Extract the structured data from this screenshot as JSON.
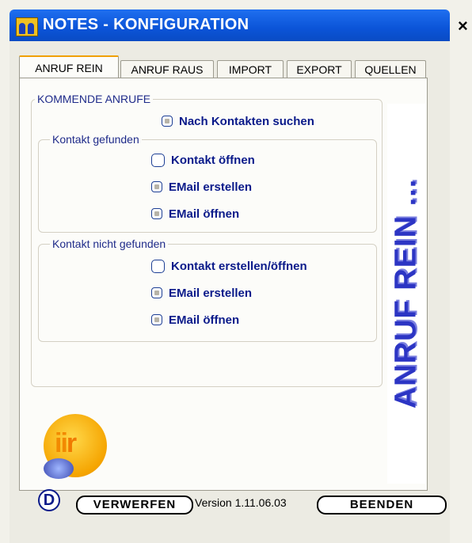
{
  "window": {
    "title": "NOTES - KONFIGURATION",
    "close_glyph": "×"
  },
  "tabs": [
    {
      "label": "ANRUF REIN",
      "active": true
    },
    {
      "label": "ANRUF RAUS",
      "active": false
    },
    {
      "label": "IMPORT",
      "active": false
    },
    {
      "label": "EXPORT",
      "active": false
    },
    {
      "label": "QUELLEN",
      "active": false
    }
  ],
  "incoming": {
    "legend": "KOMMENDE ANRUFE",
    "search_contacts": {
      "label": "Nach Kontakten suchen",
      "checked": true
    },
    "found": {
      "legend": "Kontakt gefunden",
      "options": [
        {
          "label": "Kontakt öffnen",
          "checked": false
        },
        {
          "label": "EMail erstellen",
          "checked": true
        },
        {
          "label": "EMail öffnen",
          "checked": true
        }
      ]
    },
    "not_found": {
      "legend": "Kontakt nicht gefunden",
      "options": [
        {
          "label": "Kontakt erstellen/öffnen",
          "checked": false
        },
        {
          "label": "EMail erstellen",
          "checked": true
        },
        {
          "label": "EMail öffnen",
          "checked": true
        }
      ]
    }
  },
  "banner": {
    "text": "ANRUF REIN ..."
  },
  "footer": {
    "d_label": "D",
    "discard_label": "VERWERFEN",
    "version": "Version 1.11.06.03",
    "exit_label": "BEENDEN"
  },
  "colors": {
    "title_bar": "#0b54d8",
    "label_text": "#0a1a8a",
    "banner_text": "#2c35c4",
    "active_tab_accent": "#f0a000"
  },
  "icons": [
    "app-icon",
    "close-icon",
    "logo-icon"
  ]
}
